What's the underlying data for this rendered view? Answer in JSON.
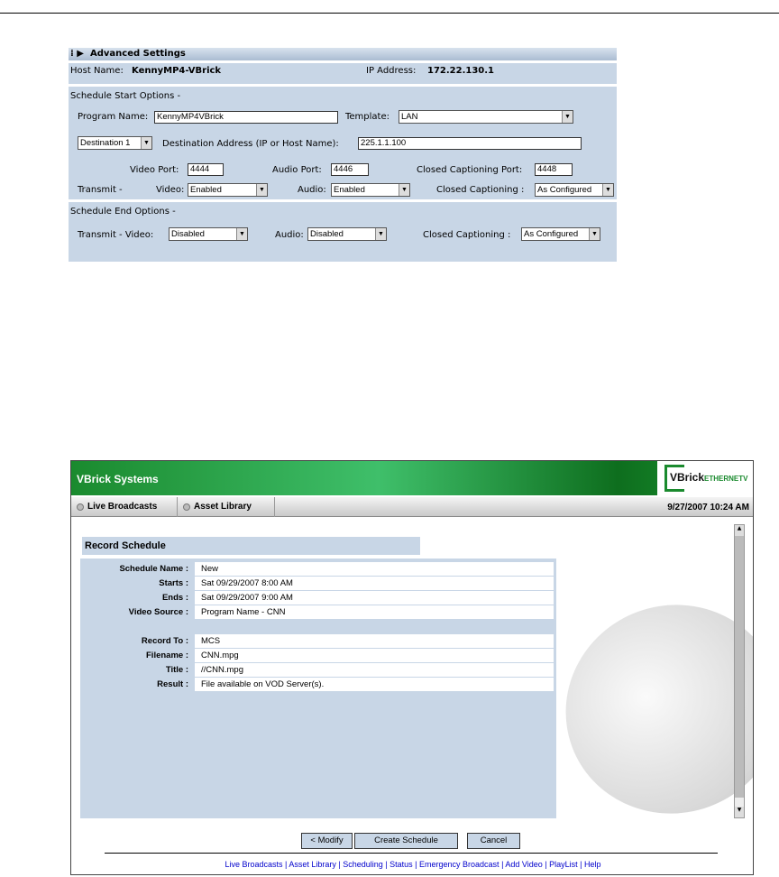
{
  "advanced": {
    "title": "Advanced Settings",
    "host_label": "Host Name:",
    "host_value": "KennyMP4-VBrick",
    "ip_label": "IP Address:",
    "ip_value": "172.22.130.1",
    "start_title": "Schedule Start Options -",
    "program_label": "Program Name:",
    "program_value": "KennyMP4VBrick",
    "template_label": "Template:",
    "template_value": "LAN",
    "destination_select": "Destination 1",
    "dest_addr_label": "Destination Address (IP or Host Name):",
    "dest_addr_value": "225.1.1.100",
    "video_port_label": "Video Port:",
    "video_port": "4444",
    "audio_port_label": "Audio Port:",
    "audio_port": "4446",
    "cc_port_label": "Closed Captioning Port:",
    "cc_port": "4448",
    "transmit_label": "Transmit -",
    "video_label": "Video:",
    "video_value": "Enabled",
    "audio_label": "Audio:",
    "audio_value": "Enabled",
    "cc_label": "Closed Captioning :",
    "cc_value": "As Configured",
    "end_title": "Schedule End Options -",
    "end_transmit_label": "Transmit -  Video:",
    "end_video_value": "Disabled",
    "end_audio_label": "Audio:",
    "end_audio_value": "Disabled",
    "end_cc_label": "Closed Captioning :",
    "end_cc_value": "As Configured"
  },
  "app": {
    "title": "VBrick Systems",
    "logo_text": "VBrick ETHERNETV SUITE",
    "tabs": [
      "Live Broadcasts",
      "Asset Library"
    ],
    "datetime": "9/27/2007 10:24 AM",
    "section_title": "Record Schedule",
    "rows": [
      {
        "k": "Schedule Name :",
        "v": "New"
      },
      {
        "k": "Starts :",
        "v": "Sat 09/29/2007 8:00 AM"
      },
      {
        "k": "Ends :",
        "v": "Sat 09/29/2007 9:00 AM"
      },
      {
        "k": "Video Source :",
        "v": "Program Name - CNN"
      },
      {
        "k": "Record To :",
        "v": "MCS"
      },
      {
        "k": "Filename :",
        "v": "CNN.mpg"
      },
      {
        "k": "Title :",
        "v": "//CNN.mpg"
      },
      {
        "k": "Result :",
        "v": "File available on VOD Server(s)."
      }
    ],
    "buttons": {
      "modify": "< Modify",
      "create": "Create Schedule",
      "cancel": "Cancel"
    },
    "footer_links": [
      "Live Broadcasts",
      "Asset Library",
      "Scheduling",
      "Status",
      "Emergency Broadcast",
      "Add Video",
      "PlayList",
      "Help"
    ]
  }
}
